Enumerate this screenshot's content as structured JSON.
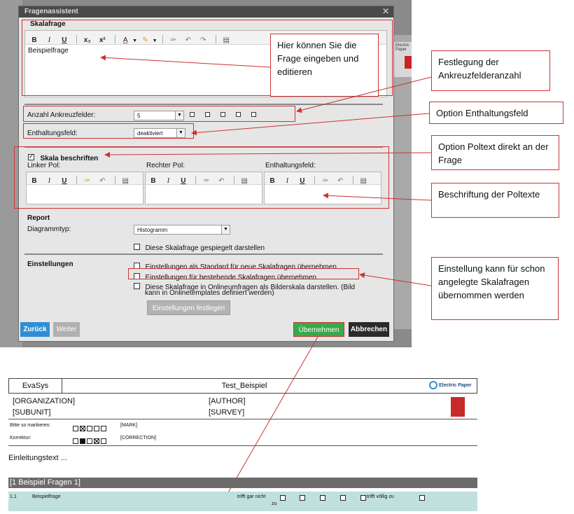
{
  "dialog": {
    "title": "Fragenassistent",
    "section_question": "Skalafrage",
    "question_text": "Beispielfrage",
    "count_label": "Anzahl Ankreuzfelder:",
    "count_value": "5",
    "abstain_label": "Enthaltungsfeld:",
    "abstain_value": "deaktiviert",
    "scale_label_checkbox": "Skala beschriften",
    "left_pole_label": "Linker Pol:",
    "right_pole_label": "Rechter Pol:",
    "abstain_field_label": "Enthaltungsfeld:",
    "report_title": "Report",
    "chart_type_label": "Diagrammtyp:",
    "chart_type_value": "Histogramm",
    "mirror_label": "Diese Skalafrage gespiegelt darstellen",
    "settings_title": "Einstellungen",
    "opt_default": "Einstellungen als Standard für neue Skalafragen übernehmen",
    "opt_existing": "Einstellungen für bestehende Skalafragen übernehmen",
    "opt_image_line1": "Diese Skalafrage in Onlineumfragen als Bilderskala darstellen. (Bild",
    "opt_image_line2": "kann in Onlinetemplates definiert werden)",
    "apply_settings": "Einstellungen festlegen",
    "back": "Zurück",
    "next": "Weiter",
    "accept": "Übernehmen",
    "cancel": "Abbrechen",
    "toolbar": {
      "bold": "B",
      "italic": "I",
      "underline": "U",
      "sub": "x₂",
      "sup": "x²",
      "color": "A"
    }
  },
  "callouts": {
    "edit_question": "Hier können Sie die Frage eingeben und editieren",
    "checkbox_count": "Festlegung der Ankreuzfelderanzahl",
    "abstain_option": "Option Enthaltungsfeld",
    "pole_text_option": "Option Poltext direkt an der Frage",
    "pole_labels": "Beschriftung der Poltexte",
    "existing_settings": "Einstellung kann für schon angelegte Skalafragen übernommen werden"
  },
  "background": {
    "ep_text": "Electric Paper"
  },
  "sheet": {
    "brand": "EvaSys",
    "title": "Test_Beispiel",
    "logo_text": "Electric Paper",
    "organization": "[ORGANIZATION]",
    "author": "[AUTHOR]",
    "subunit": "[SUBUNIT]",
    "survey": "[SURVEY]",
    "mark_label": "Bitte so markieren:",
    "mark_tag": "[MARK]",
    "correction_label": "Korrektur:",
    "correction_tag": "[CORRECTION]",
    "intro": "Einleitungstext ...",
    "section": "[1  Beispiel Fragen 1]",
    "q_number": "1.1",
    "q_text": "Beispielfrage",
    "left_pole_1": "trifft gar nicht",
    "left_pole_2": "zu",
    "right_pole": "trifft völlig zu"
  },
  "colors": {
    "titlebar": "#4a4a4a",
    "back_button": "#2e8fd4",
    "accept_button": "#3aa84a",
    "cancel_button": "#2b2b2b",
    "callout_border": "#cc3333",
    "section_bar": "#6b6b6b",
    "question_row": "#bfe0dd"
  }
}
